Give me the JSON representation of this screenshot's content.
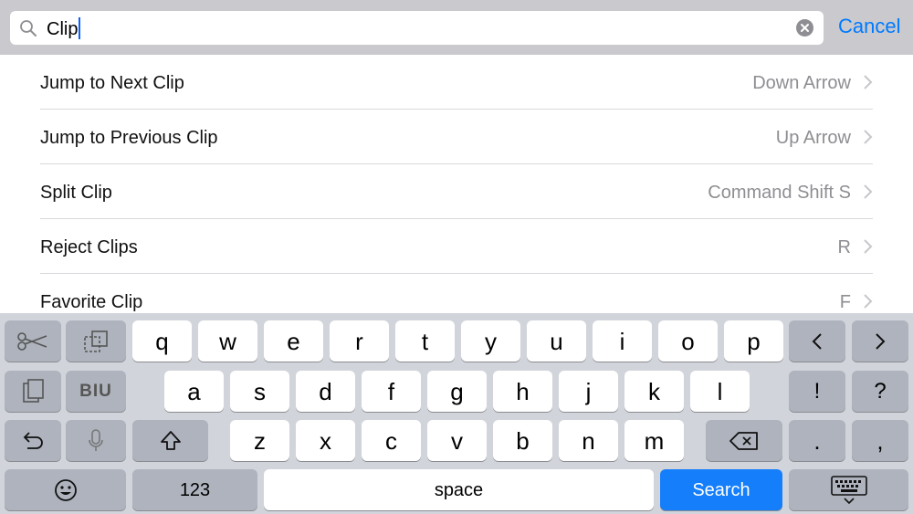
{
  "search": {
    "query": "Clip",
    "cancel_label": "Cancel"
  },
  "results": [
    {
      "title": "Jump to Next Clip",
      "shortcut": "Down Arrow"
    },
    {
      "title": "Jump to Previous Clip",
      "shortcut": "Up Arrow"
    },
    {
      "title": "Split Clip",
      "shortcut": "Command Shift S"
    },
    {
      "title": "Reject Clips",
      "shortcut": "R"
    },
    {
      "title": "Favorite Clip",
      "shortcut": "F"
    }
  ],
  "keyboard": {
    "row1": [
      "q",
      "w",
      "e",
      "r",
      "t",
      "y",
      "u",
      "i",
      "o",
      "p"
    ],
    "row2": [
      "a",
      "s",
      "d",
      "f",
      "g",
      "h",
      "j",
      "k",
      "l"
    ],
    "row3": [
      "z",
      "x",
      "c",
      "v",
      "b",
      "n",
      "m"
    ],
    "row2_right": [
      "!",
      "?"
    ],
    "row3_right": [
      ".",
      ","
    ],
    "numbers_label": "123",
    "space_label": "space",
    "search_label": "Search",
    "biu_label": "BIU",
    "icons": [
      "scissors-icon",
      "copy-icon",
      "paste-icon",
      "undo-icon",
      "microphone-icon",
      "shift-icon",
      "backspace-icon",
      "emoji-icon",
      "hide-keyboard-icon",
      "left-arrow-icon",
      "right-arrow-icon"
    ]
  },
  "colors": {
    "accent": "#007aff",
    "search_key": "#147efb",
    "header_bg": "#c9c9ce",
    "keyboard_bg": "#d1d4da"
  }
}
